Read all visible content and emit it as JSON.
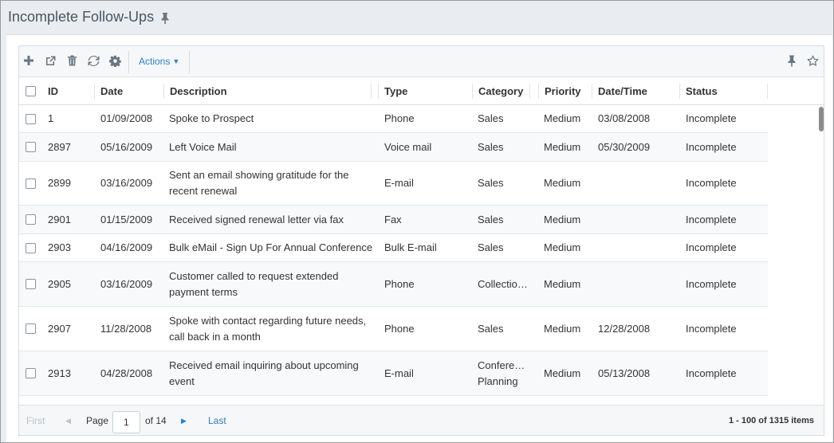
{
  "page": {
    "title": "Incomplete Follow-Ups"
  },
  "toolbar": {
    "actions_label": "Actions",
    "buttons": [
      {
        "name": "add-icon"
      },
      {
        "name": "open-external-icon"
      },
      {
        "name": "trash-icon"
      },
      {
        "name": "refresh-icon"
      },
      {
        "name": "gear-icon"
      }
    ],
    "right_buttons": [
      {
        "name": "pin-icon"
      },
      {
        "name": "star-icon"
      }
    ]
  },
  "columns": [
    "ID",
    "Date",
    "Description",
    "Type",
    "Category",
    "Priority",
    "Date/Time",
    "Status"
  ],
  "rows": [
    {
      "id": "1",
      "date": "01/09/2008",
      "description": "Spoke to Prospect",
      "type": "Phone",
      "category": "Sales",
      "priority": "Medium",
      "datetime": "03/08/2008",
      "status": "Incomplete"
    },
    {
      "id": "2897",
      "date": "05/16/2009",
      "description": "Left Voice Mail",
      "type": "Voice mail",
      "category": "Sales",
      "priority": "Medium",
      "datetime": "05/30/2009",
      "status": "Incomplete"
    },
    {
      "id": "2899",
      "date": "03/16/2009",
      "description": "Sent an email showing gratitude for the recent renewal",
      "type": "E-mail",
      "category": "Sales",
      "priority": "Medium",
      "datetime": "",
      "status": "Incomplete"
    },
    {
      "id": "2901",
      "date": "01/15/2009",
      "description": "Received signed renewal letter via fax",
      "type": "Fax",
      "category": "Sales",
      "priority": "Medium",
      "datetime": "",
      "status": "Incomplete"
    },
    {
      "id": "2903",
      "date": "04/16/2009",
      "description": "Bulk eMail - Sign Up For Annual Conference",
      "type": "Bulk E-mail",
      "category": "Sales",
      "priority": "Medium",
      "datetime": "",
      "status": "Incomplete"
    },
    {
      "id": "2905",
      "date": "03/16/2009",
      "description": "Customer called to request extended payment terms",
      "type": "Phone",
      "category": "Collectio…",
      "priority": "Medium",
      "datetime": "",
      "status": "Incomplete"
    },
    {
      "id": "2907",
      "date": "11/28/2008",
      "description": "Spoke with contact regarding future needs, call back in a month",
      "type": "Phone",
      "category": "Sales",
      "priority": "Medium",
      "datetime": "12/28/2008",
      "status": "Incomplete"
    },
    {
      "id": "2913",
      "date": "04/28/2008",
      "description": "Received email inquiring about upcoming event",
      "type": "E-mail",
      "category": "Confere… Planning",
      "priority": "Medium",
      "datetime": "05/13/2008",
      "status": "Incomplete"
    }
  ],
  "pager": {
    "first_label": "First",
    "page_label": "Page",
    "page_value": "1",
    "of_label": "of 14",
    "last_label": "Last",
    "info": "1 - 100 of 1315 items"
  },
  "colors": {
    "accent": "#2f7fc1",
    "icon": "#6b7680"
  }
}
